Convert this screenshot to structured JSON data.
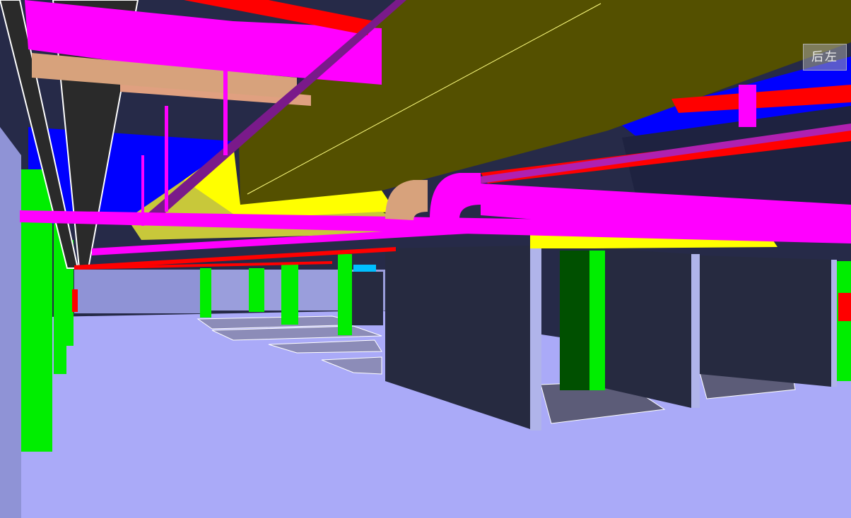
{
  "viewport": {
    "view_cube_label": "后左"
  },
  "colors": {
    "sky_blue": "#0000ff",
    "dark_ceiling": "#262a48",
    "floor": "#aaaaf8",
    "wall": "#8f93d6",
    "duct": "#545000",
    "duct_underside": "#ffff00",
    "duct_side": "#c8c83a",
    "magenta_pipe": "#ff00ff",
    "red_pipe": "#ff0000",
    "tan_pipe": "#d7a27c",
    "green_column": "#00ee00",
    "dark_green": "#005000",
    "dark_wall": "#262a40",
    "cyan_object": "#00bfff"
  },
  "icons": {
    "view_cube": "navigation-view-cube"
  }
}
